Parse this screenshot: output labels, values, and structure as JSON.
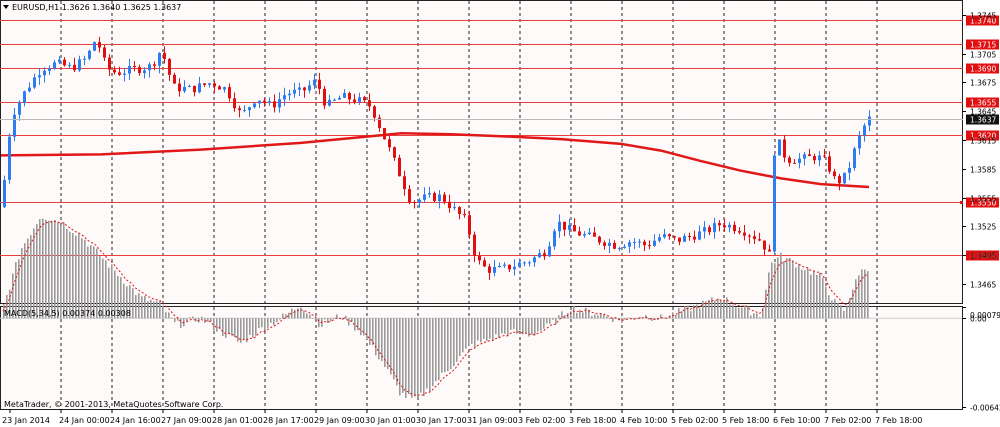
{
  "symbol_header": "EURUSD,H1  1.3626 1.3640 1.3625 1.3637",
  "macd_header": "MACD(5,34,5) 0.00374 0.00308",
  "copyright": "MetaTrader, © 2001-2013, MetaQuotes Software Corp.",
  "colors": {
    "background": "#fffafa",
    "axis_area": "#ffffff",
    "bull_candle": "#2e7df0",
    "bear_candle": "#e01010",
    "ma_line": "#e01818",
    "level_line": "#e84040",
    "grid": "#222222",
    "histogram": "#9a9a9a",
    "signal": "#e01010",
    "text": "#000000",
    "price_tag": "#e01010",
    "current_tag": "#111111"
  },
  "chart_data": [
    {
      "type": "candlestick",
      "title": "EURUSD,H1",
      "ylim": [
        1.3445,
        1.376
      ],
      "y_ticks": [
        "1.3745",
        "1.3705",
        "1.3675",
        "1.3645",
        "1.3615",
        "1.3585",
        "1.3555",
        "1.3525",
        "1.3495",
        "1.3465"
      ],
      "x_tick_labels": [
        "23 Jan 2014",
        "24 Jan 00:00",
        "24 Jan 16:00",
        "27 Jan 09:00",
        "28 Jan 01:00",
        "28 Jan 17:00",
        "29 Jan 09:00",
        "30 Jan 01:00",
        "30 Jan 17:00",
        "31 Jan 09:00",
        "3 Feb 02:00",
        "3 Feb 18:00",
        "4 Feb 10:00",
        "5 Feb 02:00",
        "5 Feb 18:00",
        "6 Feb 10:00",
        "7 Feb 02:00",
        "7 Feb 18:00"
      ],
      "horizontal_levels": [
        1.374,
        1.3715,
        1.369,
        1.3655,
        1.362,
        1.355,
        1.3495
      ],
      "horizontal_level_labels": [
        "1.3740",
        "1.3715",
        "1.3690",
        "1.3655",
        "1.3620",
        "1.3550",
        "1.3495"
      ],
      "current_price": 1.3637,
      "current_price_label": "1.3637",
      "ohlc": {
        "open": 1.3626,
        "high": 1.364,
        "low": 1.3625,
        "close": 1.3637
      },
      "close_path": [
        [
          0,
          1.3545
        ],
        [
          10,
          1.364
        ],
        [
          25,
          1.3668
        ],
        [
          40,
          1.369
        ],
        [
          55,
          1.3695
        ],
        [
          70,
          1.369
        ],
        [
          85,
          1.37
        ],
        [
          95,
          1.3722
        ],
        [
          105,
          1.369
        ],
        [
          115,
          1.3685
        ],
        [
          130,
          1.3688
        ],
        [
          150,
          1.3692
        ],
        [
          160,
          1.371
        ],
        [
          172,
          1.367
        ],
        [
          190,
          1.3668
        ],
        [
          210,
          1.3675
        ],
        [
          225,
          1.3668
        ],
        [
          240,
          1.364
        ],
        [
          255,
          1.366
        ],
        [
          270,
          1.365
        ],
        [
          285,
          1.3664
        ],
        [
          300,
          1.3665
        ],
        [
          315,
          1.3677
        ],
        [
          325,
          1.365
        ],
        [
          340,
          1.366
        ],
        [
          355,
          1.3657
        ],
        [
          370,
          1.365
        ],
        [
          380,
          1.3625
        ],
        [
          390,
          1.36
        ],
        [
          400,
          1.3575
        ],
        [
          410,
          1.355
        ],
        [
          425,
          1.3555
        ],
        [
          440,
          1.3556
        ],
        [
          455,
          1.354
        ],
        [
          465,
          1.353
        ],
        [
          475,
          1.349
        ],
        [
          485,
          1.348
        ],
        [
          500,
          1.348
        ],
        [
          515,
          1.3485
        ],
        [
          530,
          1.349
        ],
        [
          545,
          1.35
        ],
        [
          555,
          1.353
        ],
        [
          570,
          1.352
        ],
        [
          585,
          1.3515
        ],
        [
          600,
          1.351
        ],
        [
          615,
          1.3505
        ],
        [
          630,
          1.351
        ],
        [
          645,
          1.3505
        ],
        [
          660,
          1.3515
        ],
        [
          675,
          1.351
        ],
        [
          690,
          1.3515
        ],
        [
          705,
          1.352
        ],
        [
          720,
          1.3528
        ],
        [
          740,
          1.3522
        ],
        [
          760,
          1.351
        ],
        [
          768,
          1.3495
        ],
        [
          772,
          1.36
        ],
        [
          776,
          1.3615
        ],
        [
          785,
          1.3595
        ],
        [
          800,
          1.3595
        ],
        [
          815,
          1.3598
        ],
        [
          825,
          1.3592
        ],
        [
          835,
          1.357
        ],
        [
          845,
          1.3578
        ],
        [
          855,
          1.361
        ],
        [
          862,
          1.3628
        ],
        [
          868,
          1.3637
        ]
      ],
      "moving_average": [
        [
          0,
          1.3599
        ],
        [
          100,
          1.36
        ],
        [
          200,
          1.3605
        ],
        [
          300,
          1.3612
        ],
        [
          380,
          1.362
        ],
        [
          400,
          1.3622
        ],
        [
          450,
          1.3621
        ],
        [
          500,
          1.3619
        ],
        [
          560,
          1.3616
        ],
        [
          620,
          1.3611
        ],
        [
          660,
          1.3604
        ],
        [
          700,
          1.3593
        ],
        [
          740,
          1.3583
        ],
        [
          780,
          1.3575
        ],
        [
          820,
          1.3569
        ],
        [
          868,
          1.3566
        ]
      ]
    },
    {
      "type": "bar",
      "title": "MACD(5,34,5) 0.00374 0.00308",
      "ylim": [
        -0.0066,
        0.00082
      ],
      "y_ticks": [
        "0.00079",
        "0.00",
        "-0.00642"
      ],
      "macd": 0.00374,
      "signal": 0.00308,
      "series_path": [
        [
          0,
          0.0002
        ],
        [
          20,
          0.005
        ],
        [
          40,
          0.0075
        ],
        [
          60,
          0.007
        ],
        [
          80,
          0.006
        ],
        [
          100,
          0.0045
        ],
        [
          120,
          0.003
        ],
        [
          140,
          0.0015
        ],
        [
          160,
          0.001
        ],
        [
          175,
          -0.0005
        ],
        [
          200,
          0.0
        ],
        [
          220,
          -0.001
        ],
        [
          240,
          -0.0018
        ],
        [
          260,
          -0.0008
        ],
        [
          280,
          0.0
        ],
        [
          300,
          0.001
        ],
        [
          320,
          -0.0005
        ],
        [
          340,
          0.0002
        ],
        [
          360,
          -0.001
        ],
        [
          380,
          -0.003
        ],
        [
          400,
          -0.0055
        ],
        [
          415,
          -0.006
        ],
        [
          430,
          -0.005
        ],
        [
          450,
          -0.0035
        ],
        [
          470,
          -0.002
        ],
        [
          490,
          -0.0015
        ],
        [
          510,
          -0.001
        ],
        [
          530,
          -0.0012
        ],
        [
          550,
          -0.0005
        ],
        [
          570,
          0.0008
        ],
        [
          585,
          0.0005
        ],
        [
          600,
          0.0003
        ],
        [
          620,
          -0.0002
        ],
        [
          640,
          0.0002
        ],
        [
          660,
          0.0
        ],
        [
          680,
          0.0005
        ],
        [
          700,
          0.001
        ],
        [
          720,
          0.0015
        ],
        [
          740,
          0.0008
        ],
        [
          760,
          0.0002
        ],
        [
          770,
          0.004
        ],
        [
          780,
          0.0045
        ],
        [
          800,
          0.0038
        ],
        [
          820,
          0.003
        ],
        [
          835,
          0.001
        ],
        [
          845,
          0.0005
        ],
        [
          855,
          0.003
        ],
        [
          868,
          0.0037
        ]
      ]
    }
  ]
}
